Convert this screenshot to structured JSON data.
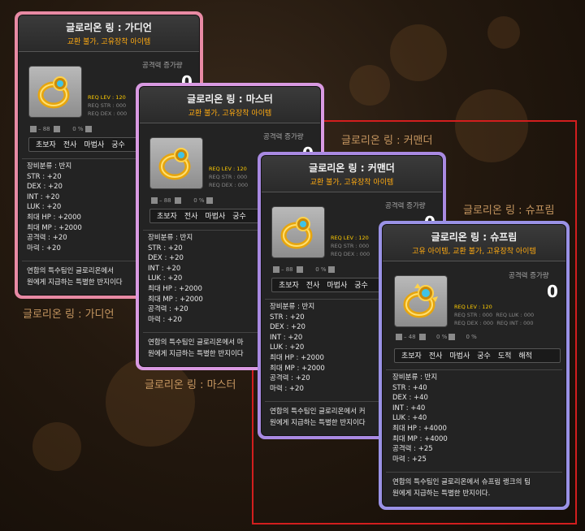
{
  "colors": {
    "guardian_border": "#e88aa4",
    "master_border": "#d99ae2",
    "commander_border": "#a98ae2",
    "supreme_border": "#9a92e6",
    "highlight_frame": "#d21e1e",
    "subtitle": "#ffaa11",
    "req_level": "#ffcc00"
  },
  "labels": {
    "guardian": "글로리온 링 : 가디언",
    "master": "글로리온 링 : 마스터",
    "commander": "글로리온 링 : 커맨더",
    "supreme": "글로리온 링 : 슈프림"
  },
  "cards": {
    "guardian": {
      "title": "글로리온 링 : 가디언",
      "subtitle": "교환 불가, 고유장착 아이템",
      "atk_label": "공격력 증가량",
      "atk_value": "0",
      "req_lev": "REQ LEV : 120",
      "req_str": "REQ STR : 000",
      "req_dex": "REQ DEX : 000",
      "stat_row": "– 88",
      "pct": "0 %",
      "jobs": [
        "초보자",
        "전사",
        "마법사",
        "궁수"
      ],
      "opts": [
        "장비분류 : 반지",
        "STR : +20",
        "DEX : +20",
        "INT : +20",
        "LUK : +20",
        "최대 HP : +2000",
        "최대 MP : +2000",
        "공격력 : +20",
        "마력 : +20"
      ],
      "desc1": "연합의 특수팀인 글로리온에서 ",
      "desc2": "원에게 지급하는 특별한 반지이다"
    },
    "master": {
      "title": "글로리온 링 : 마스터",
      "subtitle": "교환 불가, 고유장착 아이템",
      "atk_label": "공격력 증가량",
      "atk_value": "0",
      "req_lev": "REQ LEV : 120",
      "req_str": "REQ STR : 000",
      "req_dex": "REQ DEX : 000",
      "stat_row": "– 88",
      "pct": "0 %",
      "jobs": [
        "초보자",
        "전사",
        "마법사",
        "궁수"
      ],
      "opts": [
        "장비분류 : 반지",
        "STR : +20",
        "DEX : +20",
        "INT : +20",
        "LUK : +20",
        "최대 HP : +2000",
        "최대 MP : +2000",
        "공격력 : +20",
        "마력 : +20"
      ],
      "desc1": "연합의 특수팀인 글로리온에서 마",
      "desc2": "원에게 지급하는 특별한 반지이다"
    },
    "commander": {
      "title": "글로리온 링 : 커맨더",
      "subtitle": "교환 불가, 고유장착 아이템",
      "atk_label": "공격력 증가량",
      "atk_value": "0",
      "req_lev": "REQ LEV : 120",
      "req_str": "REQ STR : 000",
      "req_dex": "REQ DEX : 000",
      "stat_row": "– 88",
      "pct": "0 %",
      "jobs": [
        "초보자",
        "전사",
        "마법사",
        "궁수"
      ],
      "opts": [
        "장비분류 : 반지",
        "STR : +20",
        "DEX : +20",
        "INT : +20",
        "LUK : +20",
        "최대 HP : +2000",
        "최대 MP : +2000",
        "공격력 : +20",
        "마력 : +20"
      ],
      "desc1": "연합의 특수팀인 글로리온에서 커",
      "desc2": "원에게 지급하는 특별한 반지이다"
    },
    "supreme": {
      "title": "글로리온 링 : 슈프림",
      "subtitle": "고유 아이템, 교환 불가, 고유장착 아이템",
      "atk_label": "공격력 증가량",
      "atk_value": "0",
      "req_lev": "REQ LEV : 120",
      "req_str": "REQ STR : 000",
      "req_dex": "REQ DEX : 000",
      "req_luk": "REQ LUK : 000",
      "req_int": "REQ INT : 000",
      "stat_row": "– 48",
      "pct1": "0 %",
      "pct2": "0 %",
      "jobs": [
        "초보자",
        "전사",
        "마법사",
        "궁수",
        "도적",
        "해적"
      ],
      "opts": [
        "장비분류 : 반지",
        "STR : +40",
        "DEX : +40",
        "INT : +40",
        "LUK : +40",
        "최대 HP : +4000",
        "최대 MP : +4000",
        "공격력 : +25",
        "마력 : +25"
      ],
      "desc1": "연합의 특수팀인 글로리온에서 슈프림 랭크의 팀",
      "desc2": "원에게 지급하는 특별한 반지이다."
    }
  }
}
